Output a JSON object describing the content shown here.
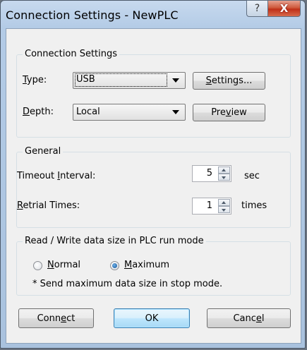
{
  "window": {
    "title": "Connection Settings - NewPLC",
    "help_icon_glyph": "?",
    "close_icon_glyph": "X"
  },
  "connection": {
    "group_title": "Connection Settings",
    "type_label_ul": "T",
    "type_label_rest": "ype:",
    "type_value": "USB",
    "settings_button_ul": "S",
    "settings_button_rest": "ettings...",
    "depth_label_ul": "D",
    "depth_label_rest": "epth:",
    "depth_value": "Local",
    "preview_button_pre": "Pre",
    "preview_button_ul": "v",
    "preview_button_post": "iew"
  },
  "general": {
    "group_title": "General",
    "timeout_label_pre": "Timeout ",
    "timeout_label_ul": "I",
    "timeout_label_post": "nterval:",
    "timeout_value": "5",
    "timeout_unit": "sec",
    "retrial_label_ul": "R",
    "retrial_label_rest": "etrial Times:",
    "retrial_value": "1",
    "retrial_unit": "times"
  },
  "readwrite": {
    "group_title": "Read / Write data size in PLC run mode",
    "normal_ul": "N",
    "normal_rest": "ormal",
    "maximum_ul": "M",
    "maximum_rest": "aximum",
    "selected": "Maximum",
    "note": "* Send maximum data size in stop mode."
  },
  "footer": {
    "connect_pre": "Conn",
    "connect_ul": "e",
    "connect_post": "ct",
    "ok": "OK",
    "cancel_pre": "Canc",
    "cancel_ul": "e",
    "cancel_post": "l"
  },
  "colors": {
    "title_bar": "#b3cbe6",
    "close_button": "#c03018",
    "dialog_bg": "#f0f0f0",
    "default_button_border": "#3c7fb1"
  }
}
